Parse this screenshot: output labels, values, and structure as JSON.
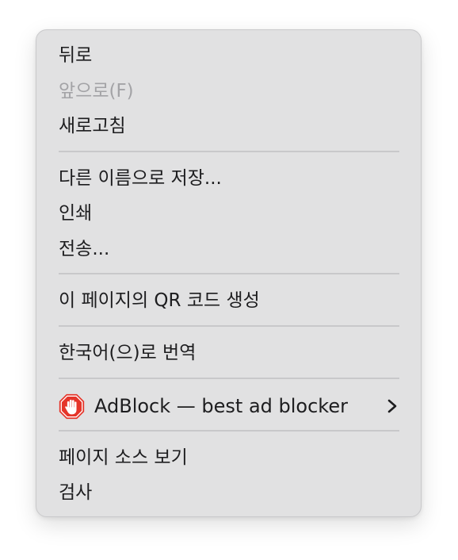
{
  "menu": {
    "items": {
      "back": "뒤로",
      "forward": "앞으로(F)",
      "reload": "새로고침",
      "save_as": "다른 이름으로 저장...",
      "print": "인쇄",
      "send": "전송...",
      "qr_code": "이 페이지의 QR 코드 생성",
      "translate": "한국어(으)로 번역",
      "adblock": "AdBlock — best ad blocker",
      "view_source": "페이지 소스 보기",
      "inspect": "검사"
    },
    "adblock_icon": "adblock-stop-hand-icon",
    "submenu_indicator": "chevron-right-icon",
    "colors": {
      "background": "#e1e1e2",
      "text": "#1d1d1f",
      "disabled_text": "#a3a3a6",
      "separator": "#c8c8ca",
      "adblock_red": "#e5352a"
    }
  }
}
